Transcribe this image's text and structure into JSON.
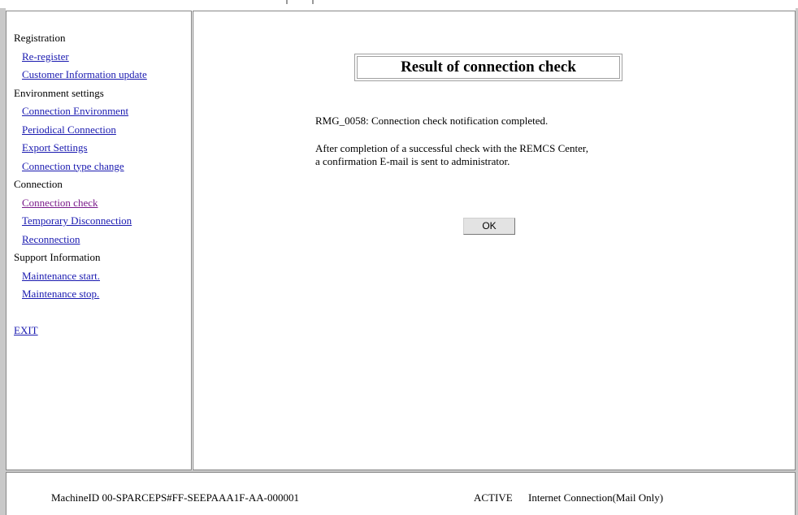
{
  "nav": {
    "groups": [
      {
        "label": "Registration",
        "items": [
          "Re-register",
          "Customer Information update"
        ]
      },
      {
        "label": "Environment settings",
        "items": [
          "Connection Environment",
          "Periodical Connection",
          "Export Settings",
          "Connection type change"
        ]
      },
      {
        "label": "Connection",
        "items": [
          "Connection check",
          "Temporary Disconnection",
          "Reconnection"
        ]
      },
      {
        "label": "Support Information",
        "items": [
          "Maintenance start.",
          "Maintenance stop."
        ]
      }
    ],
    "exit_label": "EXIT"
  },
  "main": {
    "title": "Result of connection check",
    "message_code": "RMG_0058: Connection check notification completed.",
    "message_line1": "After completion of a successful check with the REMCS Center,",
    "message_line2": "a confirmation E-mail is sent to administrator.",
    "ok_label": "OK"
  },
  "status": {
    "machine_id": "MachineID 00-SPARCEPS#FF-SEEPAAA1F-AA-000001",
    "state": "ACTIVE",
    "connection": "Internet Connection(Mail Only)"
  },
  "colors": {
    "link": "#1a1ab0",
    "visited_link": "#7a1a8a",
    "frame_border": "#c9c9c9"
  }
}
